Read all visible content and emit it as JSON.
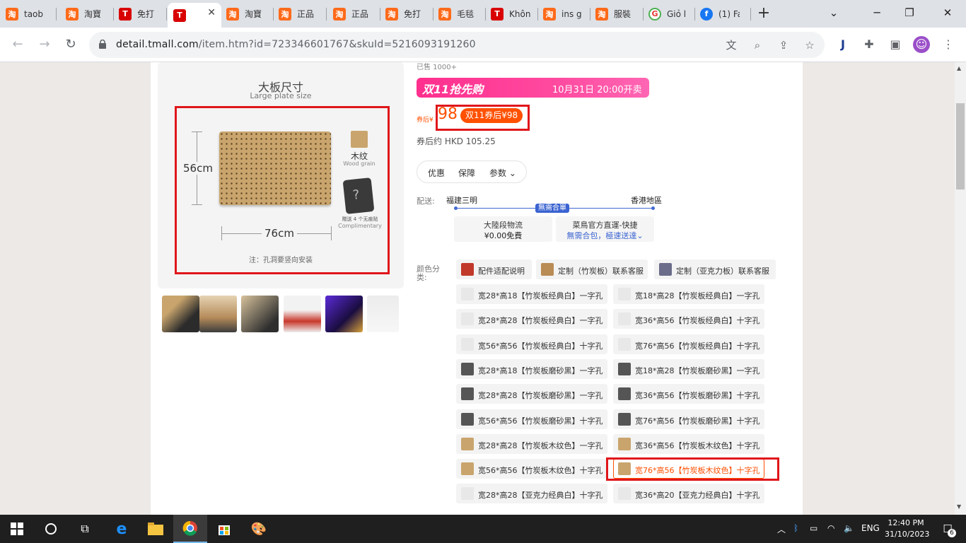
{
  "browser": {
    "tabs": [
      {
        "title": "taob",
        "icon": "taobao"
      },
      {
        "title": "淘寶",
        "icon": "taobao"
      },
      {
        "title": "免打",
        "icon": "tmall"
      },
      {
        "title": "",
        "icon": "tmall",
        "active": true
      },
      {
        "title": "淘寶",
        "icon": "taobao"
      },
      {
        "title": "正品",
        "icon": "taobao"
      },
      {
        "title": "正品",
        "icon": "taobao"
      },
      {
        "title": "免打",
        "icon": "taobao"
      },
      {
        "title": "毛毯",
        "icon": "taobao"
      },
      {
        "title": "Khôn",
        "icon": "tmall"
      },
      {
        "title": "ins g",
        "icon": "taobao"
      },
      {
        "title": "服裝",
        "icon": "taobao"
      },
      {
        "title": "Giỏ l",
        "icon": "google"
      },
      {
        "title": "(1) Fa",
        "icon": "facebook"
      }
    ],
    "url_domain": "detail.tmall.com",
    "url_path": "/item.htm?id=723346601767&skuId=5216093191260",
    "new_tab": "+",
    "close_tab": "✕"
  },
  "product": {
    "image_title": "大板尺寸",
    "image_subtitle": "Large plate size",
    "height_label": "56cm",
    "width_label": "76cm",
    "wood_label": "木纹",
    "wood_label_en": "Wood grain",
    "gift_label": "赠送 4 个无痕贴",
    "gift_label_en": "Complimentary",
    "note": "注：孔洞要竖向安装",
    "sold": "已售 1000+",
    "banner_title": "双11抢先购",
    "banner_date": "10月31日 20:00开卖",
    "coupon_label": "券后¥",
    "price": "98",
    "coupon_tag": "双11券后¥98",
    "hkd": "券后约 HKD 105.25",
    "pills": [
      "优惠",
      "保障",
      "参数 ⌄"
    ],
    "ship_label": "配送:",
    "ship_from": "福建三明",
    "ship_to": "香港地區",
    "route_tag": "無需合單",
    "ship1_l1": "大陸段物流",
    "ship1_l2": "¥0.00免費",
    "ship2_l1": "菜鳥官方直運-快捷",
    "ship2_l2": "無需合包，極速送達⌄",
    "color_label": "颜色分类:"
  },
  "skus": [
    "配件适配说明",
    "定制（竹炭板）联系客服",
    "定制（亚克力板）联系客服",
    "宽28*高18【竹炭板经典白】一字孔",
    "宽18*高28【竹炭板经典白】一字孔",
    "宽28*高28【竹炭板经典白】一字孔",
    "宽36*高56【竹炭板经典白】十字孔",
    "宽56*高56【竹炭板经典白】十字孔",
    "宽76*高56【竹炭板经典白】十字孔",
    "宽28*高18【竹炭板磨砂黑】一字孔",
    "宽18*高28【竹炭板磨砂黑】一字孔",
    "宽28*高28【竹炭板磨砂黑】一字孔",
    "宽36*高56【竹炭板磨砂黑】十字孔",
    "宽56*高56【竹炭板磨砂黑】十字孔",
    "宽76*高56【竹炭板磨砂黑】十字孔",
    "宽28*高28【竹炭板木纹色】一字孔",
    "宽36*高56【竹炭板木纹色】十字孔",
    "宽56*高56【竹炭板木纹色】十字孔",
    "宽76*高56【竹炭板木纹色】十字孔",
    "宽28*高28【亚克力经典白】十字孔",
    "宽36*高20【亚克力经典白】十字孔"
  ],
  "taskbar": {
    "time": "12:40 PM",
    "date": "31/10/2023",
    "lang": "ENG",
    "notifications": "6"
  },
  "colors": {
    "accent": "#ff5000",
    "highlight": "#e0161b",
    "banner": "#ff3d99"
  }
}
